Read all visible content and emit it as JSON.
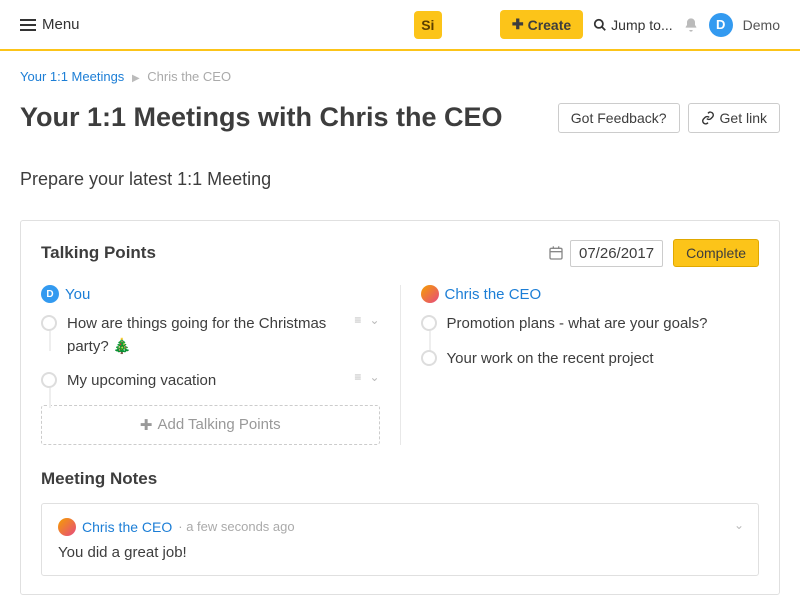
{
  "topbar": {
    "menu_label": "Menu",
    "logo_text": "Si",
    "create_label": "Create",
    "jump_label": "Jump to...",
    "user_initial": "D",
    "user_name": "Demo"
  },
  "breadcrumb": {
    "root": "Your 1:1 Meetings",
    "current": "Chris the CEO"
  },
  "page": {
    "title": "Your 1:1 Meetings with Chris the CEO",
    "feedback_btn": "Got Feedback?",
    "getlink_btn": "Get link",
    "prepare_label": "Prepare your latest 1:1 Meeting"
  },
  "talking_points": {
    "title": "Talking Points",
    "date": "07/26/2017",
    "complete_btn": "Complete",
    "you": {
      "initial": "D",
      "label": "You",
      "items": [
        "How are things going for the Christmas party? 🎄",
        "My upcoming vacation"
      ],
      "add_label": "Add Talking Points"
    },
    "other": {
      "label": "Chris the CEO",
      "items": [
        "Promotion plans - what are your goals?",
        "Your work on the recent project"
      ]
    }
  },
  "meeting_notes": {
    "title": "Meeting Notes",
    "note": {
      "author": "Chris the CEO",
      "time": "· a few seconds ago",
      "body": "You did a great job!"
    }
  }
}
